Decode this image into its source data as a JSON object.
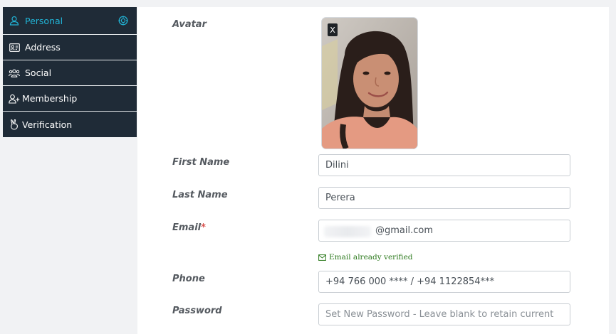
{
  "sidebar": {
    "items": [
      {
        "label": "Personal",
        "icon": "user-icon",
        "active": true
      },
      {
        "label": "Address",
        "icon": "address-card-icon"
      },
      {
        "label": "Social",
        "icon": "users-icon"
      },
      {
        "label": "Membership",
        "icon": "user-plus-icon"
      },
      {
        "label": "Verification",
        "icon": "victory-hand-icon"
      }
    ]
  },
  "form": {
    "avatar_label": "Avatar",
    "avatar_remove": "X",
    "first_name_label": "First Name",
    "first_name_value": "Dilini",
    "last_name_label": "Last Name",
    "last_name_value": "Perera",
    "email_label": "Email",
    "email_required": "*",
    "email_value": "@gmail.com",
    "email_verified": "Email already verified",
    "phone_label": "Phone",
    "phone_value": "+94 766 000 **** / +94 1122854***",
    "password_label": "Password",
    "password_placeholder": "Set New Password - Leave blank to retain current"
  },
  "colors": {
    "sidebar_bg": "#1f2b37",
    "accent": "#21b4d6",
    "success": "#2d7a1e",
    "required": "#d9534f"
  }
}
